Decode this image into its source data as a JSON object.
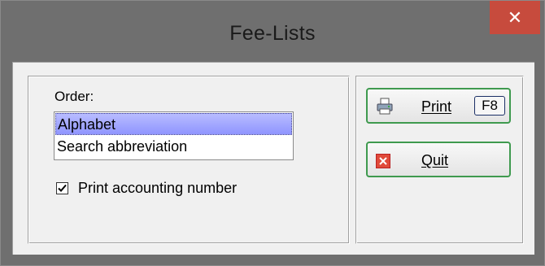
{
  "window": {
    "title": "Fee-Lists",
    "close_glyph": "✕"
  },
  "order": {
    "label": "Order:",
    "items": [
      {
        "label": "Alphabet",
        "selected": true
      },
      {
        "label": "Search abbreviation",
        "selected": false
      }
    ]
  },
  "options": {
    "print_accounting_number": {
      "label": "Print accounting number",
      "checked": true
    }
  },
  "buttons": {
    "print": {
      "label": "Print",
      "hotkey": "F8",
      "icon": "printer-icon"
    },
    "quit": {
      "label": "Quit",
      "icon": "quit-icon"
    }
  },
  "colors": {
    "titlebar": "#6f6f6f",
    "close": "#c74b3d",
    "button_border": "#3f9a4f",
    "selection": "#8f95ff"
  }
}
